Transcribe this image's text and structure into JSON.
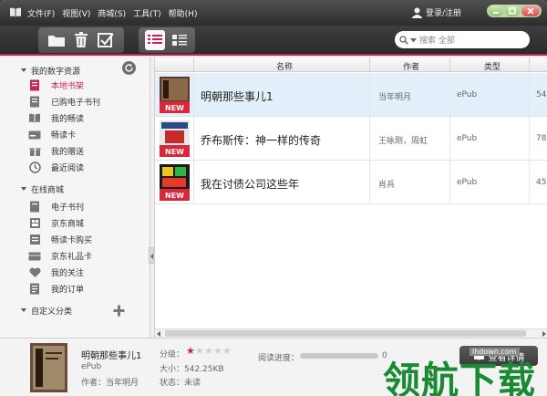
{
  "titlebar": {
    "menu": [
      "文件(F)",
      "视图(V)",
      "商城(S)",
      "工具(T)",
      "帮助(H)"
    ],
    "login": "登录/注册"
  },
  "toolbar": {
    "search_placeholder": "搜索 全部"
  },
  "sidebar": {
    "section_mine": "我的数字资源",
    "mine_items": [
      {
        "label": "本地书架",
        "icon": "bookshelf-icon",
        "active": true
      },
      {
        "label": "已购电子书刊",
        "icon": "purchased-icon"
      },
      {
        "label": "我的畅读",
        "icon": "open-book-icon"
      },
      {
        "label": "畅读卡",
        "icon": "card-icon"
      },
      {
        "label": "我的赠送",
        "icon": "gift-icon"
      },
      {
        "label": "最近阅读",
        "icon": "clock-icon"
      }
    ],
    "section_store": "在线商城",
    "store_items": [
      {
        "label": "电子书刊",
        "icon": "ebook-icon"
      },
      {
        "label": "京东商城",
        "icon": "store-icon"
      },
      {
        "label": "畅读卡购买",
        "icon": "card-buy-icon"
      },
      {
        "label": "京东礼品卡",
        "icon": "gift-card-icon"
      },
      {
        "label": "我的关注",
        "icon": "heart-icon"
      },
      {
        "label": "我的订单",
        "icon": "order-icon"
      }
    ],
    "section_custom": "自定义分类"
  },
  "list": {
    "columns": {
      "name": "名称",
      "author": "作者",
      "type": "类型"
    },
    "rows": [
      {
        "name": "明朝那些事儿1",
        "author": "当年明月",
        "type": "ePub",
        "size": "54",
        "badge": "NEW",
        "cover_color": "#8a2a2a"
      },
      {
        "name": "乔布斯传：神一样的传奇",
        "author": "王咏刚，周虹",
        "type": "ePub",
        "size": "78",
        "badge": "NEW",
        "cover_color": "#2a4a8a"
      },
      {
        "name": "我在讨债公司这些年",
        "author": "肖兵",
        "type": "ePub",
        "size": "45",
        "badge": "NEW",
        "cover_color": "#2a8a4a"
      }
    ]
  },
  "detail": {
    "title": "明朝那些事儿1",
    "format": "ePub",
    "author_label": "作者：当年明月",
    "rating_label": "分级：",
    "rating": 1,
    "rating_max": 5,
    "size_label": "大小：542.25KB",
    "status_label": "状态：未读",
    "progress_label": "阅读进度：",
    "progress": 0,
    "progress_text": "0",
    "read_button": "查看详情"
  },
  "watermark": {
    "text": "领航下载",
    "site": "lhdown.com"
  },
  "colors": {
    "accent": "#c81e5c",
    "titlebar": "#3c3c3c",
    "selected_row": "#e3f0fb",
    "watermark": "#1a8a35"
  }
}
